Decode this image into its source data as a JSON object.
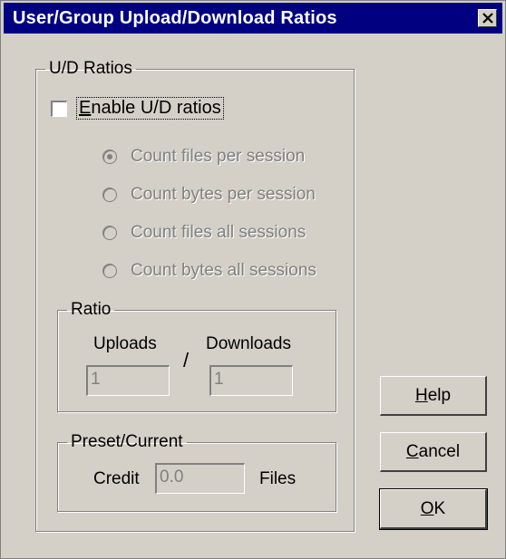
{
  "window": {
    "title": "User/Group Upload/Download Ratios",
    "close_icon": "close-icon"
  },
  "ud_ratios": {
    "group_label": "U/D Ratios",
    "enable_checkbox": {
      "label": "Enable U/D ratios",
      "checked": false
    },
    "radios": [
      {
        "label": "Count files per session",
        "selected": true
      },
      {
        "label": "Count bytes per session",
        "selected": false
      },
      {
        "label": "Count files all sessions",
        "selected": false
      },
      {
        "label": "Count bytes all sessions",
        "selected": false
      }
    ]
  },
  "ratio": {
    "group_label": "Ratio",
    "uploads_label": "Uploads",
    "downloads_label": "Downloads",
    "separator": "/",
    "uploads_value": "1",
    "downloads_value": "1"
  },
  "preset": {
    "group_label": "Preset/Current",
    "credit_label": "Credit",
    "credit_value": "0.0",
    "files_label": "Files"
  },
  "buttons": {
    "help": "Help",
    "cancel": "Cancel",
    "ok": "OK"
  }
}
